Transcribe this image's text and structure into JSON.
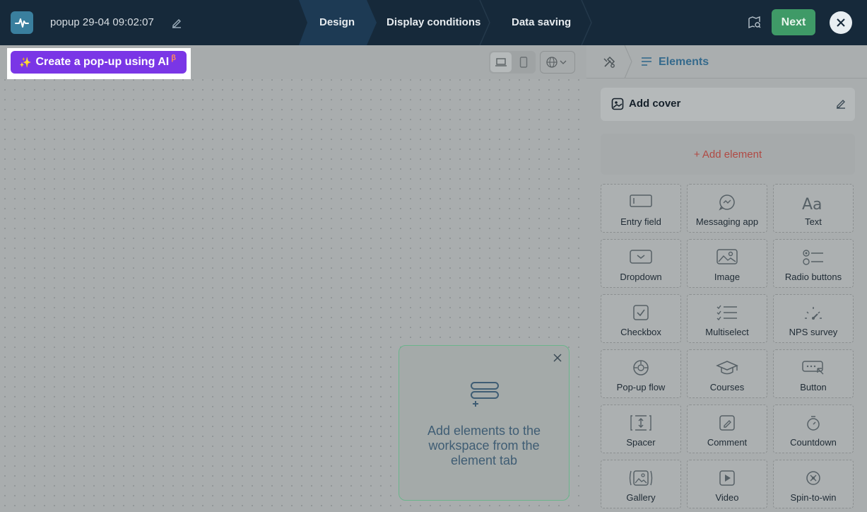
{
  "header": {
    "popup_name": "popup 29-04 09:02:07",
    "steps": [
      "Design",
      "Display conditions",
      "Data saving"
    ],
    "next_label": "Next"
  },
  "canvas": {
    "ai_button_label": "Create a pop-up using AI",
    "ai_beta": "β",
    "hint_text": "Add elements to the workspace from the element tab"
  },
  "panel": {
    "title": "Elements",
    "cover_label": "Add cover",
    "add_element_label": "+ Add element",
    "tiles": [
      {
        "label": "Entry field",
        "icon": "entry-field-icon"
      },
      {
        "label": "Messaging app",
        "icon": "messaging-app-icon"
      },
      {
        "label": "Text",
        "icon": "text-icon"
      },
      {
        "label": "Dropdown",
        "icon": "dropdown-icon"
      },
      {
        "label": "Image",
        "icon": "image-icon"
      },
      {
        "label": "Radio buttons",
        "icon": "radio-buttons-icon"
      },
      {
        "label": "Checkbox",
        "icon": "checkbox-icon"
      },
      {
        "label": "Multiselect",
        "icon": "multiselect-icon"
      },
      {
        "label": "NPS survey",
        "icon": "nps-survey-icon"
      },
      {
        "label": "Pop-up flow",
        "icon": "popup-flow-icon"
      },
      {
        "label": "Courses",
        "icon": "courses-icon"
      },
      {
        "label": "Button",
        "icon": "button-icon"
      },
      {
        "label": "Spacer",
        "icon": "spacer-icon"
      },
      {
        "label": "Comment",
        "icon": "comment-icon"
      },
      {
        "label": "Countdown",
        "icon": "countdown-icon"
      },
      {
        "label": "Gallery",
        "icon": "gallery-icon"
      },
      {
        "label": "Video",
        "icon": "video-icon"
      },
      {
        "label": "Spin-to-win",
        "icon": "spin-to-win-icon"
      }
    ]
  },
  "colors": {
    "topbar": "#16293a",
    "next": "#3f9a67",
    "ai": "#7a36e6",
    "accent_title": "#356a8c",
    "add_element": "#b04a44"
  }
}
